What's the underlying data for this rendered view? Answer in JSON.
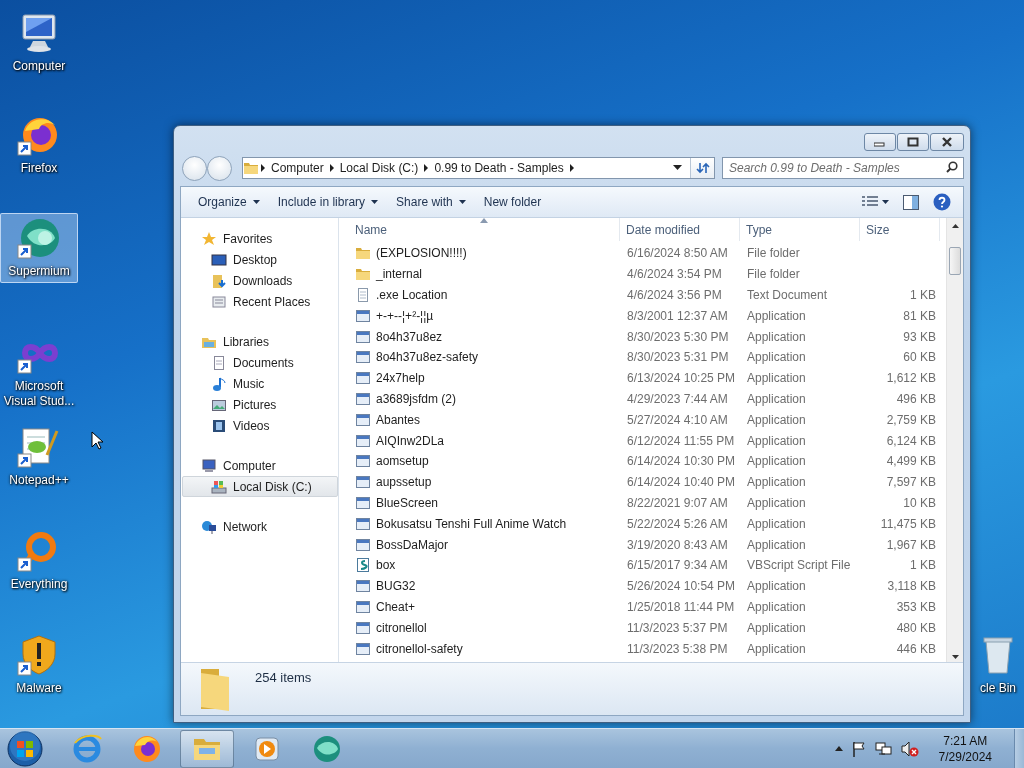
{
  "desktop": {
    "icons": [
      {
        "label": "Computer",
        "kind": "computer",
        "shortcut": false,
        "selected": false
      },
      {
        "label": "Firefox",
        "kind": "firefox",
        "shortcut": true,
        "selected": false
      },
      {
        "label": "Supermium",
        "kind": "supermium",
        "shortcut": true,
        "selected": true
      },
      {
        "label": "Microsoft Visual Stud...",
        "kind": "visual-studio",
        "shortcut": true,
        "selected": false
      },
      {
        "label": "Notepad++",
        "kind": "notepad",
        "shortcut": true,
        "selected": false
      },
      {
        "label": "Everything",
        "kind": "everything",
        "shortcut": true,
        "selected": false
      },
      {
        "label": "Malware",
        "kind": "malware",
        "shortcut": true,
        "selected": false
      },
      {
        "label": "cle Bin",
        "kind": "recycle-bin",
        "shortcut": false,
        "selected": false
      }
    ]
  },
  "window": {
    "address": {
      "crumbs": [
        "Computer",
        "Local Disk (C:)",
        "0.99 to Death - Samples"
      ]
    },
    "search": {
      "placeholder": "Search 0.99 to Death - Samples"
    },
    "toolbar": [
      {
        "label": "Organize",
        "dropdown": true
      },
      {
        "label": "Include in library",
        "dropdown": true
      },
      {
        "label": "Share with",
        "dropdown": true
      },
      {
        "label": "New folder",
        "dropdown": false
      }
    ],
    "sidebar": [
      {
        "label": "Favorites",
        "kind": "favorites",
        "selected": false,
        "children": [
          {
            "label": "Desktop",
            "kind": "desktop",
            "selected": false
          },
          {
            "label": "Downloads",
            "kind": "downloads",
            "selected": false
          },
          {
            "label": "Recent Places",
            "kind": "recent",
            "selected": false
          }
        ]
      },
      {
        "label": "Libraries",
        "kind": "libraries",
        "selected": false,
        "children": [
          {
            "label": "Documents",
            "kind": "documents",
            "selected": false
          },
          {
            "label": "Music",
            "kind": "music",
            "selected": false
          },
          {
            "label": "Pictures",
            "kind": "pictures",
            "selected": false
          },
          {
            "label": "Videos",
            "kind": "videos",
            "selected": false
          }
        ]
      },
      {
        "label": "Computer",
        "kind": "computer",
        "selected": false,
        "children": [
          {
            "label": "Local Disk (C:)",
            "kind": "disk",
            "selected": true
          }
        ]
      },
      {
        "label": "Network",
        "kind": "network",
        "selected": false
      }
    ],
    "columns": [
      {
        "label": "Name",
        "sorted": true
      },
      {
        "label": "Date modified",
        "sorted": false
      },
      {
        "label": "Type",
        "sorted": false
      },
      {
        "label": "Size",
        "sorted": false
      }
    ],
    "rows": [
      {
        "name": "(EXPLOSION!!!!)",
        "date": "6/16/2024 8:50 AM",
        "type": "File folder",
        "kind": "folder"
      },
      {
        "name": "_internal",
        "date": "4/6/2024 3:54 PM",
        "type": "File folder",
        "kind": "folder"
      },
      {
        "name": ".exe Location",
        "date": "4/6/2024 3:56 PM",
        "type": "Text Document",
        "size": "1 KB",
        "kind": "text"
      },
      {
        "name": "+-+--¦+²-¦¦µ",
        "date": "8/3/2001 12:37 AM",
        "type": "Application",
        "size": "81 KB",
        "kind": "app"
      },
      {
        "name": "8o4h37u8ez",
        "date": "8/30/2023 5:30 PM",
        "type": "Application",
        "size": "93 KB",
        "kind": "app"
      },
      {
        "name": "8o4h37u8ez-safety",
        "date": "8/30/2023 5:31 PM",
        "type": "Application",
        "size": "60 KB",
        "kind": "app"
      },
      {
        "name": "24x7help",
        "date": "6/13/2024 10:25 PM",
        "type": "Application",
        "size": "1,612 KB",
        "kind": "app"
      },
      {
        "name": "a3689jsfdm (2)",
        "date": "4/29/2023 7:44 AM",
        "type": "Application",
        "size": "496 KB",
        "kind": "app"
      },
      {
        "name": "Abantes",
        "date": "5/27/2024 4:10 AM",
        "type": "Application",
        "size": "2,759 KB",
        "kind": "app"
      },
      {
        "name": "AIQInw2DLa",
        "date": "6/12/2024 11:55 PM",
        "type": "Application",
        "size": "6,124 KB",
        "kind": "app"
      },
      {
        "name": "aomsetup",
        "date": "6/14/2024 10:30 PM",
        "type": "Application",
        "size": "4,499 KB",
        "kind": "app"
      },
      {
        "name": "aupssetup",
        "date": "6/14/2024 10:40 PM",
        "type": "Application",
        "size": "7,597 KB",
        "kind": "app"
      },
      {
        "name": "BlueScreen",
        "date": "8/22/2021 9:07 AM",
        "type": "Application",
        "size": "10 KB",
        "kind": "app"
      },
      {
        "name": "Bokusatsu Tenshi Full Anime Watch",
        "date": "5/22/2024 5:26 AM",
        "type": "Application",
        "size": "11,475 KB",
        "kind": "app"
      },
      {
        "name": "BossDaMajor",
        "date": "3/19/2020 8:43 AM",
        "type": "Application",
        "size": "1,967 KB",
        "kind": "app"
      },
      {
        "name": "box",
        "date": "6/15/2017 9:34 AM",
        "type": "VBScript Script File",
        "size": "1 KB",
        "kind": "script"
      },
      {
        "name": "BUG32",
        "date": "5/26/2024 10:54 PM",
        "type": "Application",
        "size": "3,118 KB",
        "kind": "app"
      },
      {
        "name": "Cheat+",
        "date": "1/25/2018 11:44 PM",
        "type": "Application",
        "size": "353 KB",
        "kind": "app"
      },
      {
        "name": "citronellol",
        "date": "11/3/2023 5:37 PM",
        "type": "Application",
        "size": "480 KB",
        "kind": "app"
      },
      {
        "name": "citronellol-safety",
        "date": "11/3/2023 5:38 PM",
        "type": "Application",
        "size": "446 KB",
        "kind": "app"
      }
    ],
    "status": "254 items"
  },
  "taskbar": {
    "buttons": [
      {
        "kind": "ie",
        "selected": false
      },
      {
        "kind": "firefox",
        "selected": false
      },
      {
        "kind": "explorer",
        "selected": true
      },
      {
        "kind": "media",
        "selected": false
      },
      {
        "kind": "supermium",
        "selected": false
      }
    ],
    "time": "7:21 AM",
    "date": "7/29/2024"
  }
}
